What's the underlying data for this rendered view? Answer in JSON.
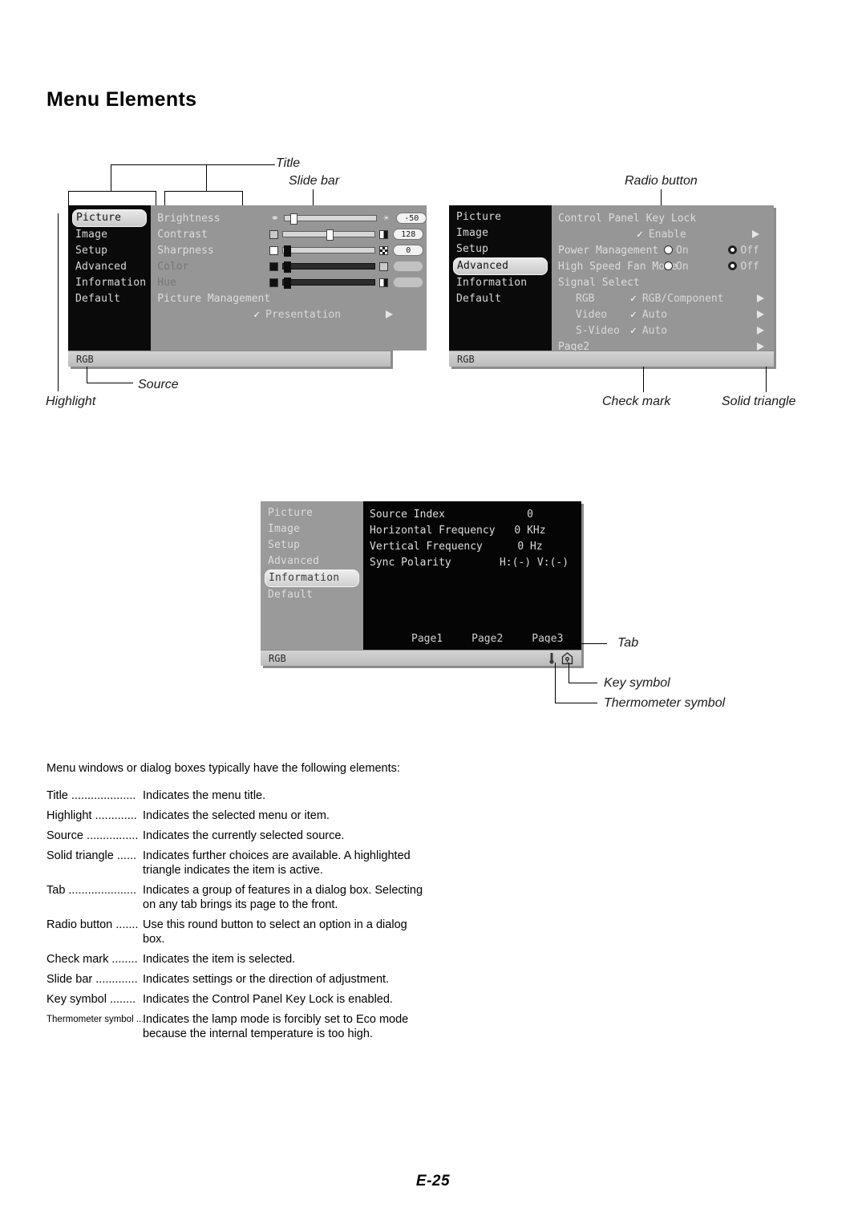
{
  "page": {
    "title": "Menu Elements",
    "page_number": "E-25"
  },
  "callouts": {
    "title": "Title",
    "slide_bar": "Slide bar",
    "source": "Source",
    "highlight": "Highlight",
    "radio_button": "Radio button",
    "check_mark": "Check mark",
    "solid_triangle": "Solid triangle",
    "tab": "Tab",
    "key_symbol": "Key symbol",
    "thermometer_symbol": "Thermometer symbol"
  },
  "sidebar_items": [
    "Picture",
    "Image",
    "Setup",
    "Advanced",
    "Information",
    "Default"
  ],
  "menu_picture": {
    "source": "RGB",
    "selected_sidebar": "Picture",
    "rows": [
      {
        "label": "Brightness",
        "value": "-50"
      },
      {
        "label": "Contrast",
        "value": "128"
      },
      {
        "label": "Sharpness",
        "value": "0"
      },
      {
        "label": "Color",
        "value": ""
      },
      {
        "label": "Hue",
        "value": ""
      }
    ],
    "picture_management_label": "Picture Management",
    "picture_management_value": "Presentation"
  },
  "menu_advanced": {
    "source": "RGB",
    "selected_sidebar": "Advanced",
    "control_panel_key_lock_label": "Control Panel Key Lock",
    "control_panel_key_lock_value": "Enable",
    "power_management_label": "Power Management",
    "high_speed_fan_label": "High Speed Fan Mode",
    "radio_on_label": "On",
    "radio_off_label": "Off",
    "signal_select_label": "Signal Select",
    "signal_rows": [
      {
        "label": "RGB",
        "value": "RGB/Component"
      },
      {
        "label": "Video",
        "value": "Auto"
      },
      {
        "label": "S-Video",
        "value": "Auto"
      }
    ],
    "page2_label": "Page2"
  },
  "menu_information": {
    "source": "RGB",
    "selected_sidebar": "Information",
    "rows": [
      {
        "label": "Source Index",
        "value": "0"
      },
      {
        "label": "Horizontal Frequency",
        "value": "0 KHz"
      },
      {
        "label": "Vertical Frequency",
        "value": "0 Hz"
      },
      {
        "label": "Sync Polarity",
        "value": "H:(-)  V:(-)"
      }
    ],
    "tabs": [
      "Page1",
      "Page2",
      "Page3"
    ]
  },
  "description": {
    "intro": "Menu windows or dialog boxes typically have the following elements:",
    "items": [
      {
        "term": "Title ....................",
        "definition": "Indicates the menu title."
      },
      {
        "term": "Highlight .............",
        "definition": "Indicates the selected menu or item."
      },
      {
        "term": "Source ................",
        "definition": "Indicates the currently selected source."
      },
      {
        "term": "Solid triangle ......",
        "definition": "Indicates further choices are available. A highlighted triangle indicates the item is active."
      },
      {
        "term": "Tab .....................",
        "definition": "Indicates a group of features in a dialog box. Selecting on any tab brings its page to the front."
      },
      {
        "term": "Radio button .......",
        "definition": "Use this round button to select an option in a dialog box."
      },
      {
        "term": "Check mark ........",
        "definition": "Indicates the item is selected."
      },
      {
        "term": "Slide bar .............",
        "definition": "Indicates settings or the direction of adjustment."
      },
      {
        "term": "Key symbol ........",
        "definition": "Indicates the Control Panel Key Lock is enabled."
      },
      {
        "term": "Thermometer symbol ...",
        "definition": "Indicates the lamp mode is forcibly set to Eco mode because the internal temperature is too high."
      }
    ]
  },
  "colors": {
    "osd_dark": "#0a0a0a",
    "osd_gray": "#969696",
    "osd_footer": "#c8c8c8",
    "highlight": "#dcdcdc"
  }
}
